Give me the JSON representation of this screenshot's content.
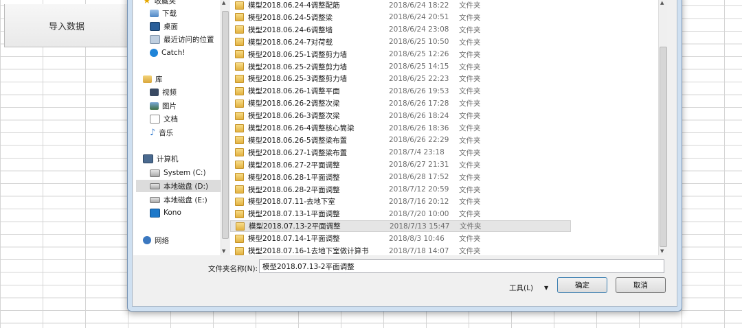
{
  "sheet": {
    "import_button": "导入数据"
  },
  "nav": {
    "items": [
      {
        "label": "收藏夹",
        "icon": "star-icon"
      },
      {
        "label": "下载",
        "icon": "download-folder-icon"
      },
      {
        "label": "桌面",
        "icon": "desktop-icon"
      },
      {
        "label": "最近访问的位置",
        "icon": "recent-places-icon"
      },
      {
        "label": "Catch!",
        "icon": "catch-app-icon"
      },
      {
        "label": "库",
        "icon": "library-icon"
      },
      {
        "label": "视频",
        "icon": "video-icon"
      },
      {
        "label": "图片",
        "icon": "pictures-icon"
      },
      {
        "label": "文档",
        "icon": "documents-icon"
      },
      {
        "label": "音乐",
        "icon": "music-icon"
      },
      {
        "label": "计算机",
        "icon": "computer-icon"
      },
      {
        "label": "System (C:)",
        "icon": "system-drive-icon"
      },
      {
        "label": "本地磁盘 (D:)",
        "icon": "drive-icon"
      },
      {
        "label": "本地磁盘 (E:)",
        "icon": "drive-icon"
      },
      {
        "label": "Kono",
        "icon": "kono-icon"
      },
      {
        "label": "网络",
        "icon": "network-icon"
      }
    ],
    "selected_index": 12
  },
  "files": [
    {
      "name": "模型2018.06.24-4调整配筋",
      "date": "2018/6/24 18:22",
      "type": "文件夹"
    },
    {
      "name": "模型2018.06.24-5调整梁",
      "date": "2018/6/24 20:51",
      "type": "文件夹"
    },
    {
      "name": "模型2018.06.24-6调整墙",
      "date": "2018/6/24 23:08",
      "type": "文件夹"
    },
    {
      "name": "模型2018.06.24-7对荷载",
      "date": "2018/6/25 10:50",
      "type": "文件夹"
    },
    {
      "name": "模型2018.06.25-1调整剪力墙",
      "date": "2018/6/25 12:26",
      "type": "文件夹"
    },
    {
      "name": "模型2018.06.25-2调整剪力墙",
      "date": "2018/6/25 14:15",
      "type": "文件夹"
    },
    {
      "name": "模型2018.06.25-3调整剪力墙",
      "date": "2018/6/25 22:23",
      "type": "文件夹"
    },
    {
      "name": "模型2018.06.26-1调整平面",
      "date": "2018/6/26 19:53",
      "type": "文件夹"
    },
    {
      "name": "模型2018.06.26-2调整次梁",
      "date": "2018/6/26 17:28",
      "type": "文件夹"
    },
    {
      "name": "模型2018.06.26-3调整次梁",
      "date": "2018/6/26 18:24",
      "type": "文件夹"
    },
    {
      "name": "模型2018.06.26-4调整核心筒梁",
      "date": "2018/6/26 18:36",
      "type": "文件夹"
    },
    {
      "name": "模型2018.06.26-5调整梁布置",
      "date": "2018/6/26 22:29",
      "type": "文件夹"
    },
    {
      "name": "模型2018.06.27-1调整梁布置",
      "date": "2018/7/4 23:18",
      "type": "文件夹"
    },
    {
      "name": "模型2018.06.27-2平面调整",
      "date": "2018/6/27 21:31",
      "type": "文件夹"
    },
    {
      "name": "模型2018.06.28-1平面调整",
      "date": "2018/6/28 17:52",
      "type": "文件夹"
    },
    {
      "name": "模型2018.06.28-2平面调整",
      "date": "2018/7/12 20:59",
      "type": "文件夹"
    },
    {
      "name": "模型2018.07.11-去地下室",
      "date": "2018/7/16 20:12",
      "type": "文件夹"
    },
    {
      "name": "模型2018.07.13-1平面调整",
      "date": "2018/7/20 10:00",
      "type": "文件夹"
    },
    {
      "name": "模型2018.07.13-2平面调整",
      "date": "2018/7/13 15:47",
      "type": "文件夹"
    },
    {
      "name": "模型2018.07.14-1平面调整",
      "date": "2018/8/3 10:46",
      "type": "文件夹"
    },
    {
      "name": "模型2018.07.16-1去地下室做计算书",
      "date": "2018/7/18 14:07",
      "type": "文件夹"
    }
  ],
  "selected_file_index": 18,
  "footer": {
    "folder_name_label": "文件夹名称(N):",
    "folder_name_value": "模型2018.07.13-2平面调整",
    "tools_label": "工具(L)",
    "ok_label": "确定",
    "cancel_label": "取消"
  }
}
